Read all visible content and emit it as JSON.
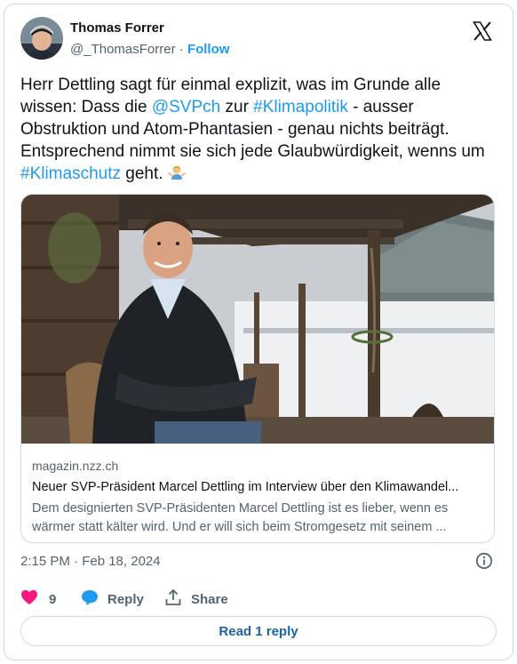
{
  "author": {
    "name": "Thomas Forrer",
    "handle": "@_ThomasForrer",
    "separator": "·",
    "follow_label": "Follow"
  },
  "icons": {
    "platform": "x-logo-icon",
    "emoji": "man-shrugging-emoji",
    "info": "info-icon",
    "like": "heart-icon",
    "reply": "speech-bubble-icon",
    "share": "share-upload-icon"
  },
  "tweet": {
    "text": [
      {
        "t": "Herr Dettling sagt für einmal explizit, was im Grunde alle wissen: Dass die ",
        "link": false
      },
      {
        "t": "@SVPch",
        "link": true
      },
      {
        "t": " zur ",
        "link": false
      },
      {
        "t": "#Klimapolitik",
        "link": true
      },
      {
        "t": " - ausser Obstruktion und Atom-Phantasien - genau nichts beiträgt. Entsprechend nimmt sie sich jede Glaubwürdigkeit, wenns um ",
        "link": false
      },
      {
        "t": "#Klimaschutz",
        "link": true
      },
      {
        "t": " geht. ",
        "link": false
      }
    ]
  },
  "link_card": {
    "domain": "magazin.nzz.ch",
    "title": "Neuer SVP-Präsident Marcel Dettling im Interview über den Klimawandel...",
    "description": "Dem designierten SVP-Präsidenten Marcel Dettling ist es lieber, wenn es wärmer statt kälter wird. Und er will sich beim Stromgesetz mit seinem ..."
  },
  "meta": {
    "timestamp": "2:15 PM · Feb 18, 2024"
  },
  "actions": {
    "like_count": "9",
    "reply_label": "Reply",
    "share_label": "Share",
    "read_replies_label": "Read 1 reply"
  },
  "colors": {
    "accent": "#1d9bf0",
    "like": "#f91880",
    "text_primary": "#0f1419",
    "text_secondary": "#536471",
    "border": "#cfd9de",
    "reply_button_text": "#1d63a9"
  }
}
